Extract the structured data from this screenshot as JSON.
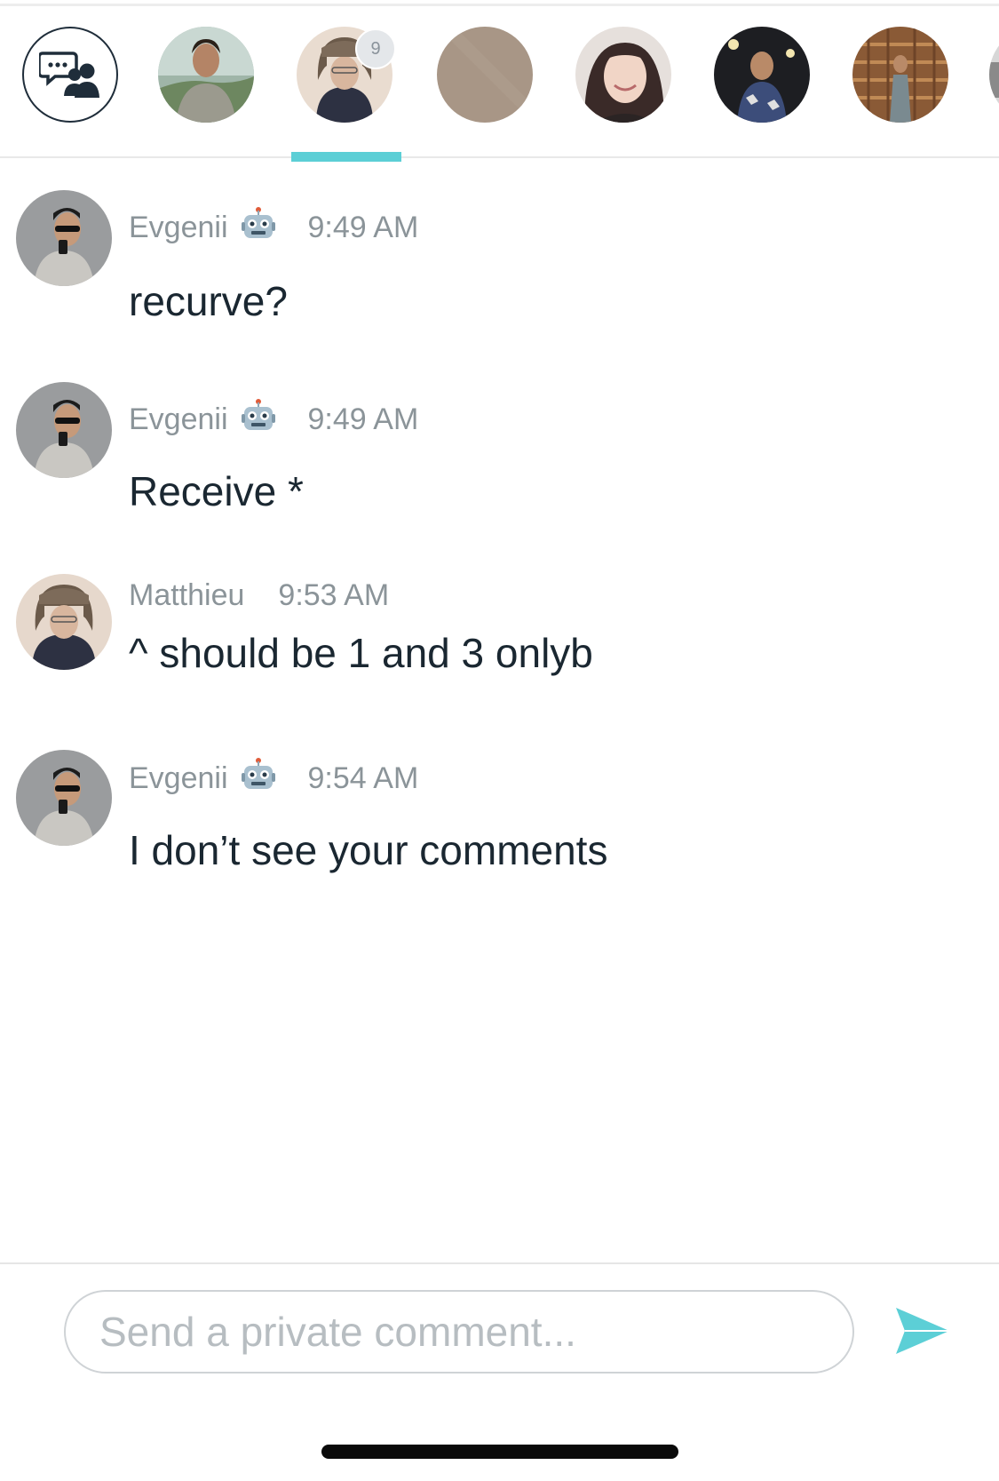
{
  "conversation_strip": {
    "group_chat": {
      "icon": "group-chat-icon"
    },
    "participants": [
      {
        "avatar": "avatar-man-outdoors",
        "active": false
      },
      {
        "avatar": "avatar-man-fur-hat",
        "active": true,
        "unread_count": "9"
      },
      {
        "avatar": "avatar-blank-beige",
        "active": false
      },
      {
        "avatar": "avatar-woman-smiling",
        "active": false
      },
      {
        "avatar": "avatar-man-night",
        "active": false
      },
      {
        "avatar": "avatar-man-temple",
        "active": false
      },
      {
        "avatar": "avatar-partial",
        "active": false
      }
    ]
  },
  "messages": [
    {
      "author": "Evgenii",
      "badge_icon": "robot-icon",
      "time": "9:49 AM",
      "text": "recurve?",
      "avatar": "avatar-evgenii"
    },
    {
      "author": "Evgenii",
      "badge_icon": "robot-icon",
      "time": "9:49 AM",
      "text": "Receive *",
      "avatar": "avatar-evgenii"
    },
    {
      "author": "Matthieu",
      "badge_icon": "",
      "time": "9:53 AM",
      "text": "^ should be 1 and 3 onlyb",
      "avatar": "avatar-matthieu"
    },
    {
      "author": "Evgenii",
      "badge_icon": "robot-icon",
      "time": "9:54 AM",
      "text": "I don’t see your comments",
      "avatar": "avatar-evgenii"
    }
  ],
  "composer": {
    "value": "",
    "placeholder": "Send a private comment...",
    "send_icon": "send-arrow-icon"
  },
  "colors": {
    "accent": "#5ccfd6",
    "text_primary": "#1a2731",
    "text_secondary": "#8b9499"
  }
}
